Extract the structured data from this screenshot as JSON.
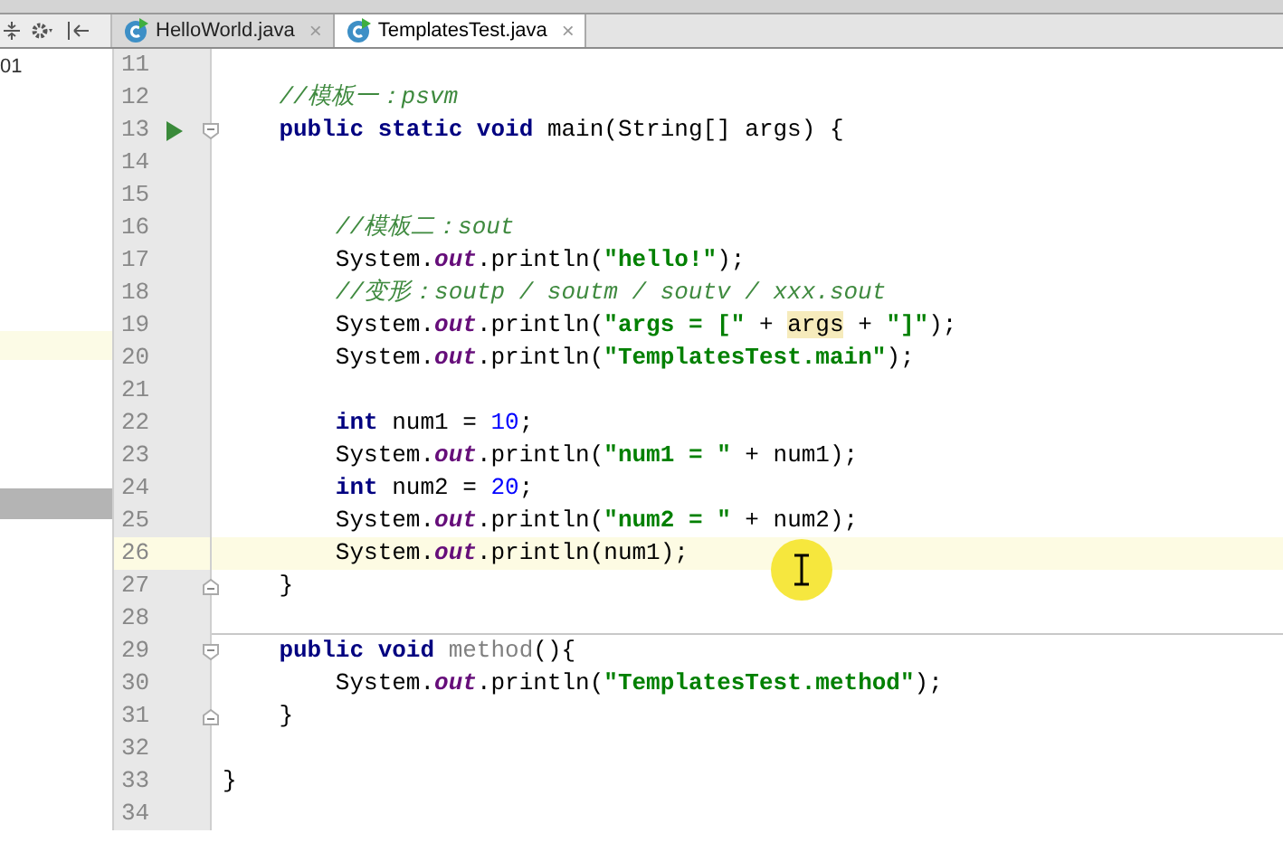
{
  "left_panel": {
    "text": "01"
  },
  "tabs": [
    {
      "label": "HelloWorld.java",
      "close": "×",
      "selected": false
    },
    {
      "label": "TemplatesTest.java",
      "close": "×",
      "selected": true
    }
  ],
  "editor": {
    "lines": [
      {
        "number": "11"
      },
      {
        "number": "12",
        "tokens": [
          {
            "kind": "comment",
            "text": "    //模板一：psvm"
          }
        ]
      },
      {
        "number": "13",
        "run": true,
        "fold_start": true,
        "tokens": [
          {
            "kind": "keyword",
            "text": "    public static void "
          },
          {
            "kind": "plain",
            "text": "main(String[] args) {"
          }
        ]
      },
      {
        "number": "14"
      },
      {
        "number": "15"
      },
      {
        "number": "16",
        "tokens": [
          {
            "kind": "comment",
            "text": "        //模板二：sout"
          }
        ]
      },
      {
        "number": "17",
        "tokens": [
          {
            "kind": "plain",
            "text": "        System."
          },
          {
            "kind": "field",
            "text": "out"
          },
          {
            "kind": "plain",
            "text": ".println("
          },
          {
            "kind": "string",
            "text": "\"hello!\""
          },
          {
            "kind": "plain",
            "text": ");"
          }
        ]
      },
      {
        "number": "18",
        "tokens": [
          {
            "kind": "comment",
            "text": "        //变形：soutp / soutm / soutv / xxx.sout"
          }
        ]
      },
      {
        "number": "19",
        "tokens": [
          {
            "kind": "plain",
            "text": "        System."
          },
          {
            "kind": "field",
            "text": "out"
          },
          {
            "kind": "plain",
            "text": ".println("
          },
          {
            "kind": "string",
            "text": "\"args = [\""
          },
          {
            "kind": "plain",
            "text": " + "
          },
          {
            "kind": "highlight",
            "text": "args"
          },
          {
            "kind": "plain",
            "text": " + "
          },
          {
            "kind": "string",
            "text": "\"]\""
          },
          {
            "kind": "plain",
            "text": ");"
          }
        ]
      },
      {
        "number": "20",
        "tokens": [
          {
            "kind": "plain",
            "text": "        System."
          },
          {
            "kind": "field",
            "text": "out"
          },
          {
            "kind": "plain",
            "text": ".println("
          },
          {
            "kind": "string",
            "text": "\"TemplatesTest.main\""
          },
          {
            "kind": "plain",
            "text": ");"
          }
        ]
      },
      {
        "number": "21"
      },
      {
        "number": "22",
        "tokens": [
          {
            "kind": "keyword",
            "text": "        int"
          },
          {
            "kind": "plain",
            "text": " num1 = "
          },
          {
            "kind": "number",
            "text": "10"
          },
          {
            "kind": "plain",
            "text": ";"
          }
        ]
      },
      {
        "number": "23",
        "tokens": [
          {
            "kind": "plain",
            "text": "        System."
          },
          {
            "kind": "field",
            "text": "out"
          },
          {
            "kind": "plain",
            "text": ".println("
          },
          {
            "kind": "string",
            "text": "\"num1 = \""
          },
          {
            "kind": "plain",
            "text": " + num1);"
          }
        ]
      },
      {
        "number": "24",
        "tokens": [
          {
            "kind": "keyword",
            "text": "        int"
          },
          {
            "kind": "plain",
            "text": " num2 = "
          },
          {
            "kind": "number",
            "text": "20"
          },
          {
            "kind": "plain",
            "text": ";"
          }
        ]
      },
      {
        "number": "25",
        "tokens": [
          {
            "kind": "plain",
            "text": "        System."
          },
          {
            "kind": "field",
            "text": "out"
          },
          {
            "kind": "plain",
            "text": ".println("
          },
          {
            "kind": "string",
            "text": "\"num2 = \""
          },
          {
            "kind": "plain",
            "text": " + num2);"
          }
        ]
      },
      {
        "number": "26",
        "current": true,
        "tokens": [
          {
            "kind": "plain",
            "text": "        System."
          },
          {
            "kind": "field",
            "text": "out"
          },
          {
            "kind": "plain",
            "text": ".println(num1);"
          }
        ]
      },
      {
        "number": "27",
        "fold_end": true,
        "tokens": [
          {
            "kind": "plain",
            "text": "    }"
          }
        ]
      },
      {
        "number": "28",
        "separator": true
      },
      {
        "number": "29",
        "fold_start": true,
        "tokens": [
          {
            "kind": "keyword",
            "text": "    public void "
          },
          {
            "kind": "unused",
            "text": "method"
          },
          {
            "kind": "plain",
            "text": "(){"
          }
        ]
      },
      {
        "number": "30",
        "tokens": [
          {
            "kind": "plain",
            "text": "        System."
          },
          {
            "kind": "field",
            "text": "out"
          },
          {
            "kind": "plain",
            "text": ".println("
          },
          {
            "kind": "string",
            "text": "\"TemplatesTest.method\""
          },
          {
            "kind": "plain",
            "text": ");"
          }
        ]
      },
      {
        "number": "31",
        "fold_end": true,
        "tokens": [
          {
            "kind": "plain",
            "text": "    }"
          }
        ]
      },
      {
        "number": "32"
      },
      {
        "number": "33",
        "tokens": [
          {
            "kind": "plain",
            "text": "}"
          }
        ]
      },
      {
        "number": "34"
      }
    ]
  }
}
